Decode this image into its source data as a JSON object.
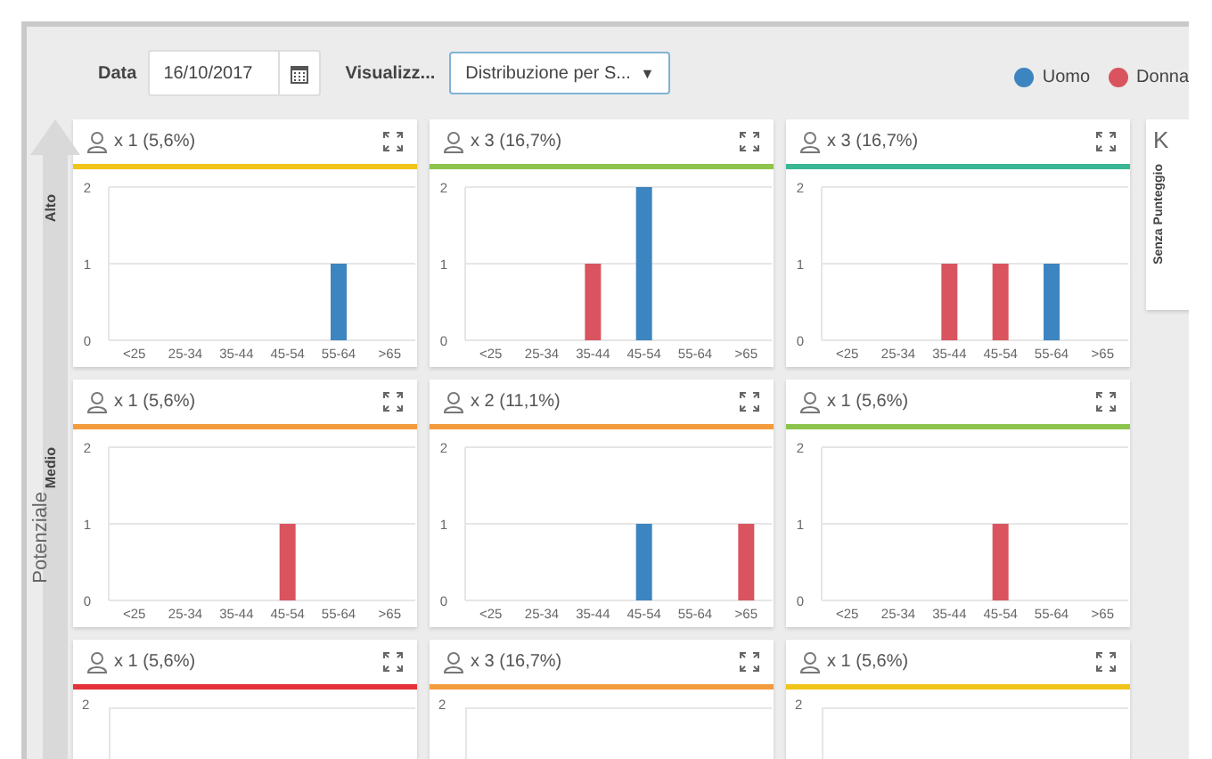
{
  "toolbar": {
    "date_label": "Data",
    "date_value": "16/10/2017",
    "view_label": "Visualizz...",
    "view_value": "Distribuzione per S...",
    "dropdown_arrow": "▼"
  },
  "legend": [
    {
      "label": "Uomo",
      "color": "#3d85c0"
    },
    {
      "label": "Donna",
      "color": "#d9545f"
    }
  ],
  "axis_title": "Potenziale",
  "rows": [
    {
      "label": "Alto",
      "cards": [
        {
          "kind": "chart",
          "header": "x 1 (5,6%)",
          "color": "#f0c419",
          "chart_data": {
            "type": "bar",
            "categories": [
              "<25",
              "25-34",
              "35-44",
              "45-54",
              "55-64",
              ">65"
            ],
            "ylim": [
              0,
              2
            ],
            "yticks": [
              0,
              1,
              2
            ],
            "series": [
              {
                "values": [
                  0,
                  0,
                  0,
                  0,
                  1,
                  0
                ]
              },
              {
                "values": [
                  0,
                  0,
                  0,
                  0,
                  0,
                  0
                ]
              }
            ]
          }
        },
        {
          "kind": "chart",
          "header": "x 3 (16,7%)",
          "color": "#8dc44e",
          "chart_data": {
            "type": "bar",
            "categories": [
              "<25",
              "25-34",
              "35-44",
              "45-54",
              "55-64",
              ">65"
            ],
            "ylim": [
              0,
              2
            ],
            "yticks": [
              0,
              1,
              2
            ],
            "series": [
              {
                "values": [
                  0,
                  0,
                  0,
                  2,
                  0,
                  0
                ]
              },
              {
                "values": [
                  0,
                  0,
                  1,
                  0,
                  0,
                  0
                ]
              }
            ]
          }
        },
        {
          "kind": "chart",
          "header": "x 3 (16,7%)",
          "color": "#3ab795",
          "chart_data": {
            "type": "bar",
            "categories": [
              "<25",
              "25-34",
              "35-44",
              "45-54",
              "55-64",
              ">65"
            ],
            "ylim": [
              0,
              2
            ],
            "yticks": [
              0,
              1,
              2
            ],
            "series": [
              {
                "values": [
                  0,
                  0,
                  0,
                  0,
                  1,
                  0
                ]
              },
              {
                "values": [
                  0,
                  0,
                  1,
                  1,
                  0,
                  0
                ]
              }
            ]
          }
        }
      ]
    },
    {
      "label": "Medio",
      "cards": [
        {
          "kind": "chart",
          "header": "x 1 (5,6%)",
          "color": "#f39c3e",
          "chart_data": {
            "type": "bar",
            "categories": [
              "<25",
              "25-34",
              "35-44",
              "45-54",
              "55-64",
              ">65"
            ],
            "ylim": [
              0,
              2
            ],
            "yticks": [
              0,
              1,
              2
            ],
            "series": [
              {
                "values": [
                  0,
                  0,
                  0,
                  0,
                  0,
                  0
                ]
              },
              {
                "values": [
                  0,
                  0,
                  0,
                  1,
                  0,
                  0
                ]
              }
            ]
          }
        },
        {
          "kind": "chart",
          "header": "x 2 (11,1%)",
          "color": "#f39c3e",
          "chart_data": {
            "type": "bar",
            "categories": [
              "<25",
              "25-34",
              "35-44",
              "45-54",
              "55-64",
              ">65"
            ],
            "ylim": [
              0,
              2
            ],
            "yticks": [
              0,
              1,
              2
            ],
            "series": [
              {
                "values": [
                  0,
                  0,
                  0,
                  1,
                  0,
                  0
                ]
              },
              {
                "values": [
                  0,
                  0,
                  0,
                  0,
                  0,
                  1
                ]
              }
            ]
          }
        },
        {
          "kind": "chart",
          "header": "x 1 (5,6%)",
          "color": "#8dc44e",
          "chart_data": {
            "type": "bar",
            "categories": [
              "<25",
              "25-34",
              "35-44",
              "45-54",
              "55-64",
              ">65"
            ],
            "ylim": [
              0,
              2
            ],
            "yticks": [
              0,
              1,
              2
            ],
            "series": [
              {
                "values": [
                  0,
                  0,
                  0,
                  0,
                  0,
                  0
                ]
              },
              {
                "values": [
                  0,
                  0,
                  0,
                  1,
                  0,
                  0
                ]
              }
            ]
          }
        }
      ]
    },
    {
      "cards": [
        {
          "kind": "cut",
          "header": "x 1 (5,6%)",
          "color": "#e5313a",
          "top_tick": "2"
        },
        {
          "kind": "cut",
          "header": "x 3 (16,7%)",
          "color": "#f39c3e",
          "top_tick": "2"
        },
        {
          "kind": "cut",
          "header": "x 1 (5,6%)",
          "color": "#f0c419",
          "top_tick": "2"
        }
      ]
    }
  ],
  "side_panel": {
    "letter": "K",
    "label": "Senza Punteggio"
  }
}
